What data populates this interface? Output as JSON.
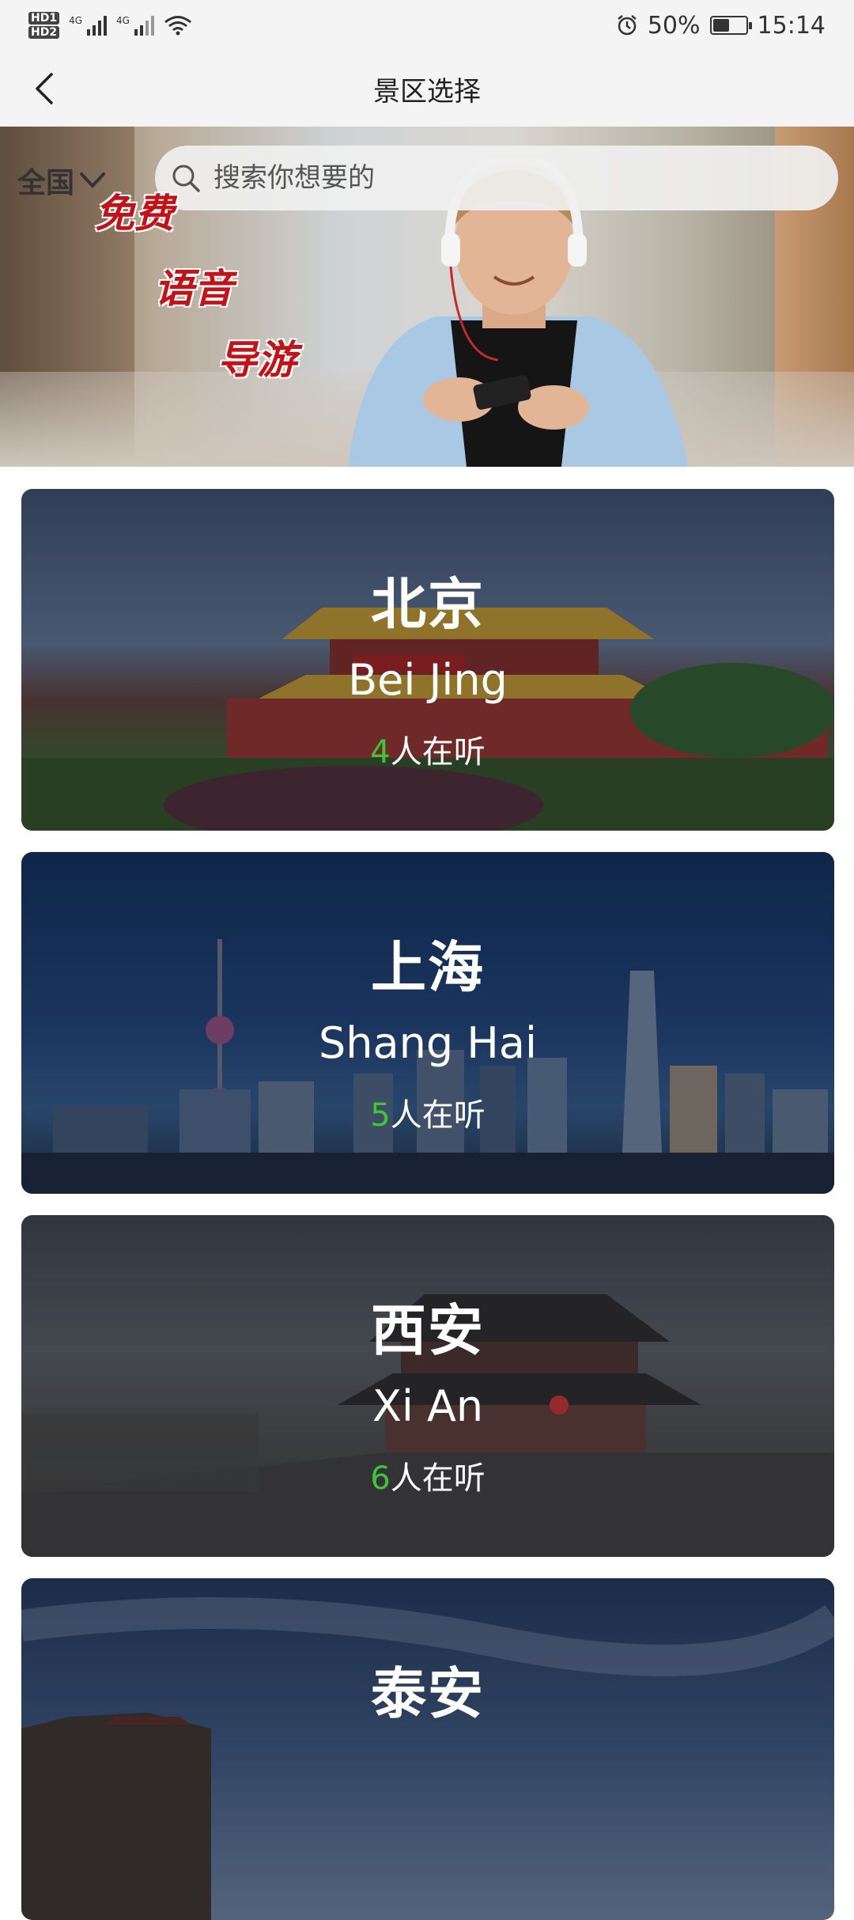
{
  "status_bar": {
    "hd1": "HD1",
    "hd2": "HD2",
    "net1": "4G",
    "net2": "4G",
    "battery": "50%",
    "battery_level": 0.5,
    "time": "15:14"
  },
  "nav": {
    "title": "景区选择"
  },
  "banner": {
    "region": "全国",
    "search_placeholder": "搜索你想要的",
    "promo": [
      "免费",
      "语音",
      "导游"
    ]
  },
  "cities": [
    {
      "name_cn": "北京",
      "name_en": "Bei Jing",
      "count": "4",
      "listen_suffix": "人在听"
    },
    {
      "name_cn": "上海",
      "name_en": "Shang Hai",
      "count": "5",
      "listen_suffix": "人在听"
    },
    {
      "name_cn": "西安",
      "name_en": "Xi An",
      "count": "6",
      "listen_suffix": "人在听"
    },
    {
      "name_cn": "泰安",
      "name_en": "",
      "count": "",
      "listen_suffix": ""
    }
  ],
  "colors": {
    "listen_count": "#3fc43a",
    "promo_red": "#c0141a"
  }
}
